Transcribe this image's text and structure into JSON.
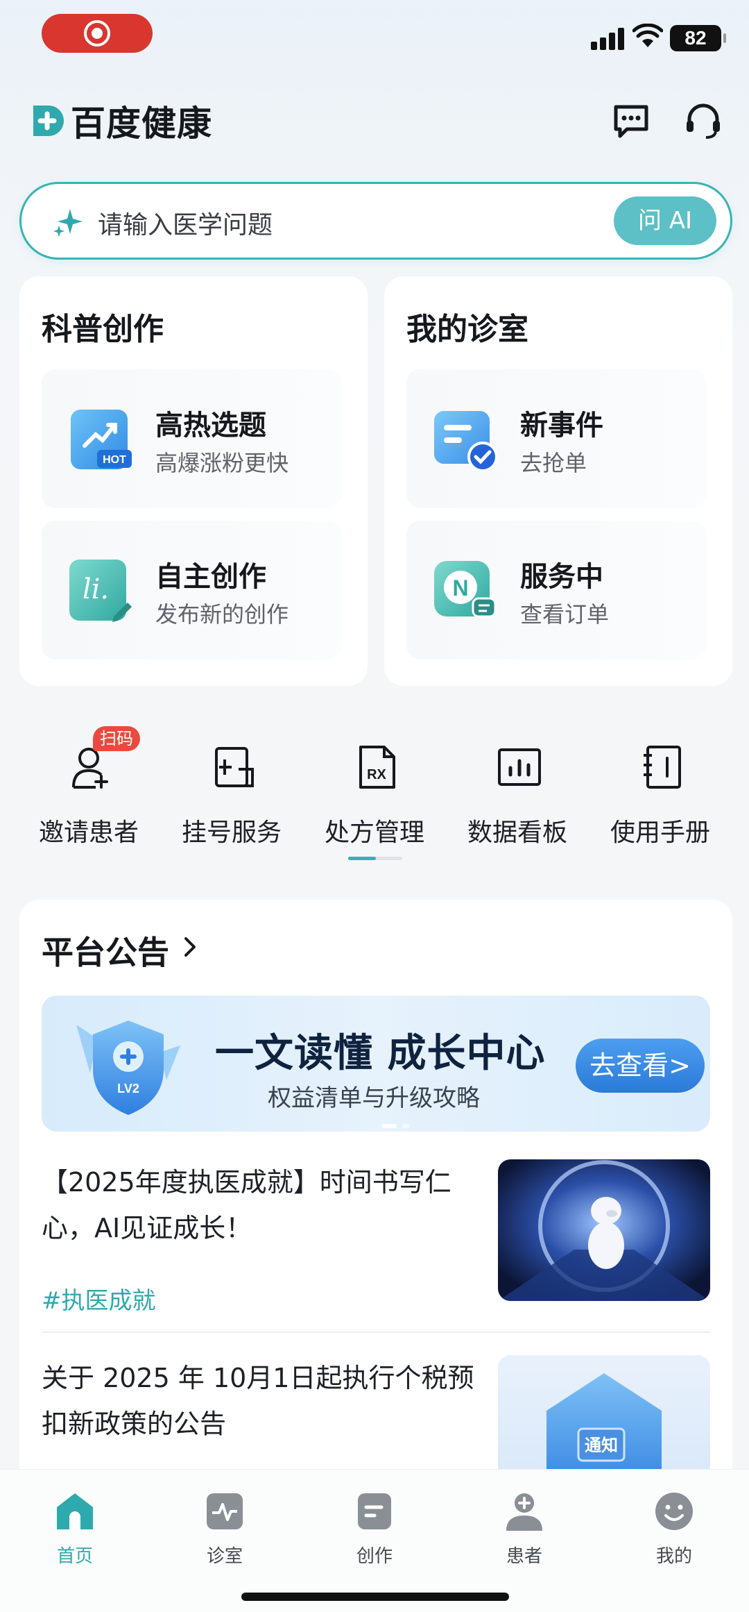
{
  "status_bar": {
    "battery": "82"
  },
  "header": {
    "logo_text": "百度健康"
  },
  "search": {
    "placeholder": "请输入医学问题",
    "ask_button": "问 AI"
  },
  "cards": {
    "science": {
      "title": "科普创作",
      "tiles": [
        {
          "title": "高热选题",
          "subtitle": "高爆涨粉更快",
          "icon_badge": "HOT",
          "icon": "trending-topic-icon"
        },
        {
          "title": "自主创作",
          "subtitle": "发布新的创作",
          "icon_glyph": "li.",
          "icon": "write-icon"
        }
      ]
    },
    "clinic": {
      "title": "我的诊室",
      "tiles": [
        {
          "title": "新事件",
          "subtitle": "去抢单",
          "icon": "new-event-icon"
        },
        {
          "title": "服务中",
          "subtitle": "查看订单",
          "icon_glyph": "N",
          "icon": "in-service-icon"
        }
      ]
    }
  },
  "quick_actions": {
    "badge": "扫码",
    "items": [
      {
        "label": "邀请患者",
        "icon": "invite-patient-icon"
      },
      {
        "label": "挂号服务",
        "icon": "registration-icon"
      },
      {
        "label": "处方管理",
        "icon": "prescription-icon",
        "icon_glyph": "RX"
      },
      {
        "label": "数据看板",
        "icon": "dashboard-icon"
      },
      {
        "label": "使用手册",
        "icon": "manual-icon"
      }
    ]
  },
  "announcements": {
    "title": "平台公告",
    "banner": {
      "headline": "一文读懂 成长中心",
      "subline": "权益清单与升级攻略",
      "button": "去查看>",
      "shield_label": "LV2"
    },
    "articles": [
      {
        "text": "【2025年度执医成就】时间书写仁心，AI见证成长！",
        "tag": "#执医成就"
      },
      {
        "text": "关于 2025 年 10月1日起执行个税预扣新政策的公告",
        "thumb_label": "通知"
      }
    ]
  },
  "tab_bar": {
    "items": [
      {
        "label": "首页",
        "active": true
      },
      {
        "label": "诊室"
      },
      {
        "label": "创作"
      },
      {
        "label": "患者"
      },
      {
        "label": "我的"
      }
    ],
    "accent": "#2ea9ad"
  },
  "colors": {
    "accent": "#37b3b7",
    "record": "#d8362f",
    "badge": "#ea4a3e",
    "banner_button": "#2a7ad9"
  }
}
